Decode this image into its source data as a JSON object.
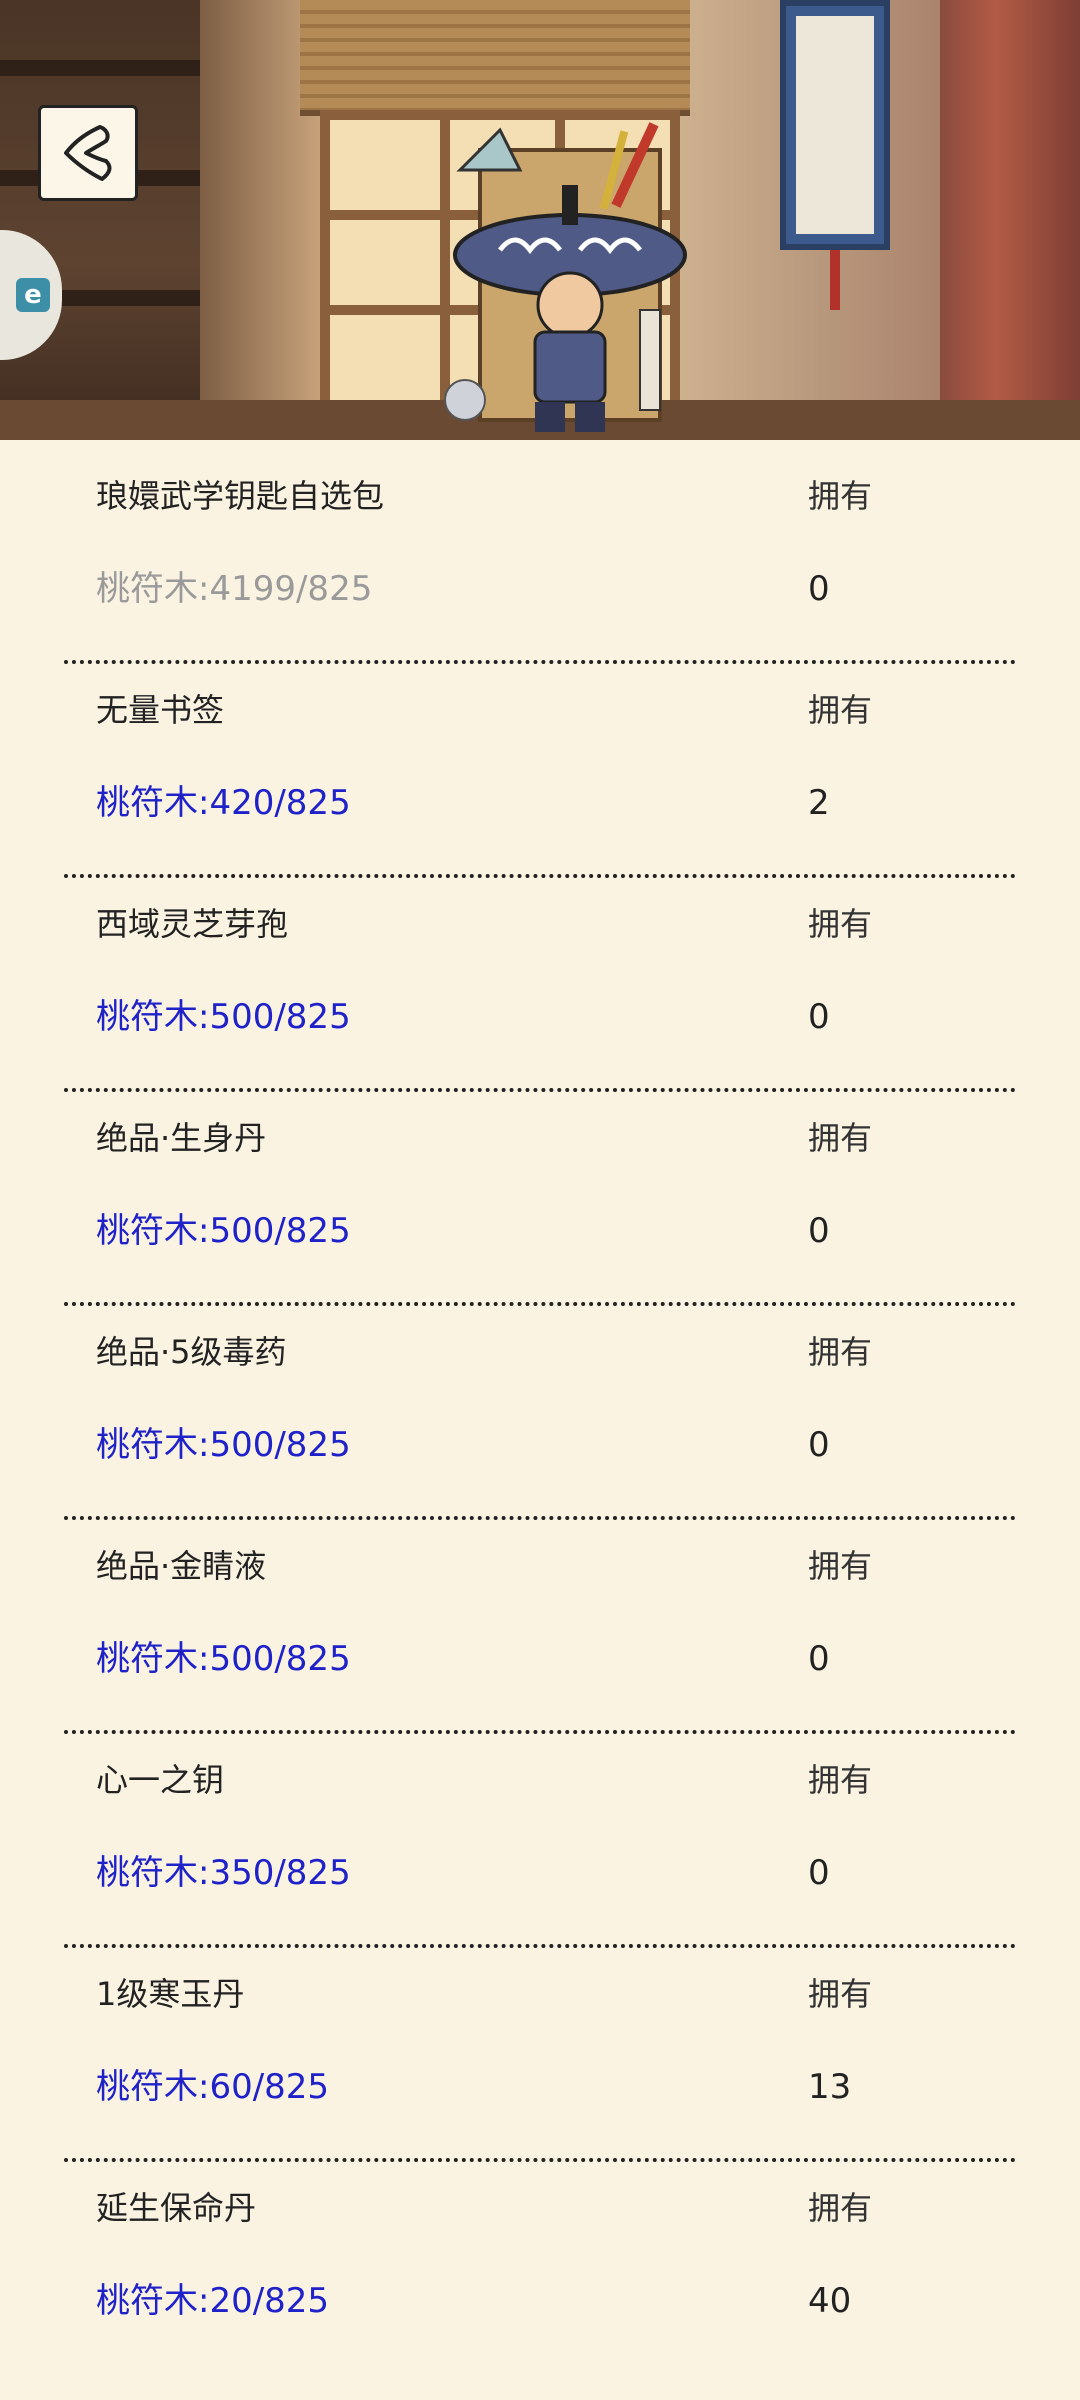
{
  "header": {
    "back_icon": "back-chevron-icon",
    "side_badge_label": "e"
  },
  "labels": {
    "own": "拥有"
  },
  "items": [
    {
      "name": "琅嬛武学钥匙自选包",
      "price": "桃符木:4199/825",
      "own": "0",
      "affordable": false
    },
    {
      "name": "无量书签",
      "price": "桃符木:420/825",
      "own": "2",
      "affordable": true
    },
    {
      "name": "西域灵芝芽孢",
      "price": "桃符木:500/825",
      "own": "0",
      "affordable": true
    },
    {
      "name": "绝品·生身丹",
      "price": "桃符木:500/825",
      "own": "0",
      "affordable": true
    },
    {
      "name": "绝品·5级毒药",
      "price": "桃符木:500/825",
      "own": "0",
      "affordable": true
    },
    {
      "name": "绝品·金睛液",
      "price": "桃符木:500/825",
      "own": "0",
      "affordable": true
    },
    {
      "name": "心一之钥",
      "price": "桃符木:350/825",
      "own": "0",
      "affordable": true
    },
    {
      "name": "1级寒玉丹",
      "price": "桃符木:60/825",
      "own": "13",
      "affordable": true
    },
    {
      "name": "延生保命丹",
      "price": "桃符木:20/825",
      "own": "40",
      "affordable": true
    }
  ],
  "colors": {
    "background": "#faf3e2",
    "price_affordable": "#1e22c8",
    "price_unaffordable": "#9a9a9a"
  }
}
